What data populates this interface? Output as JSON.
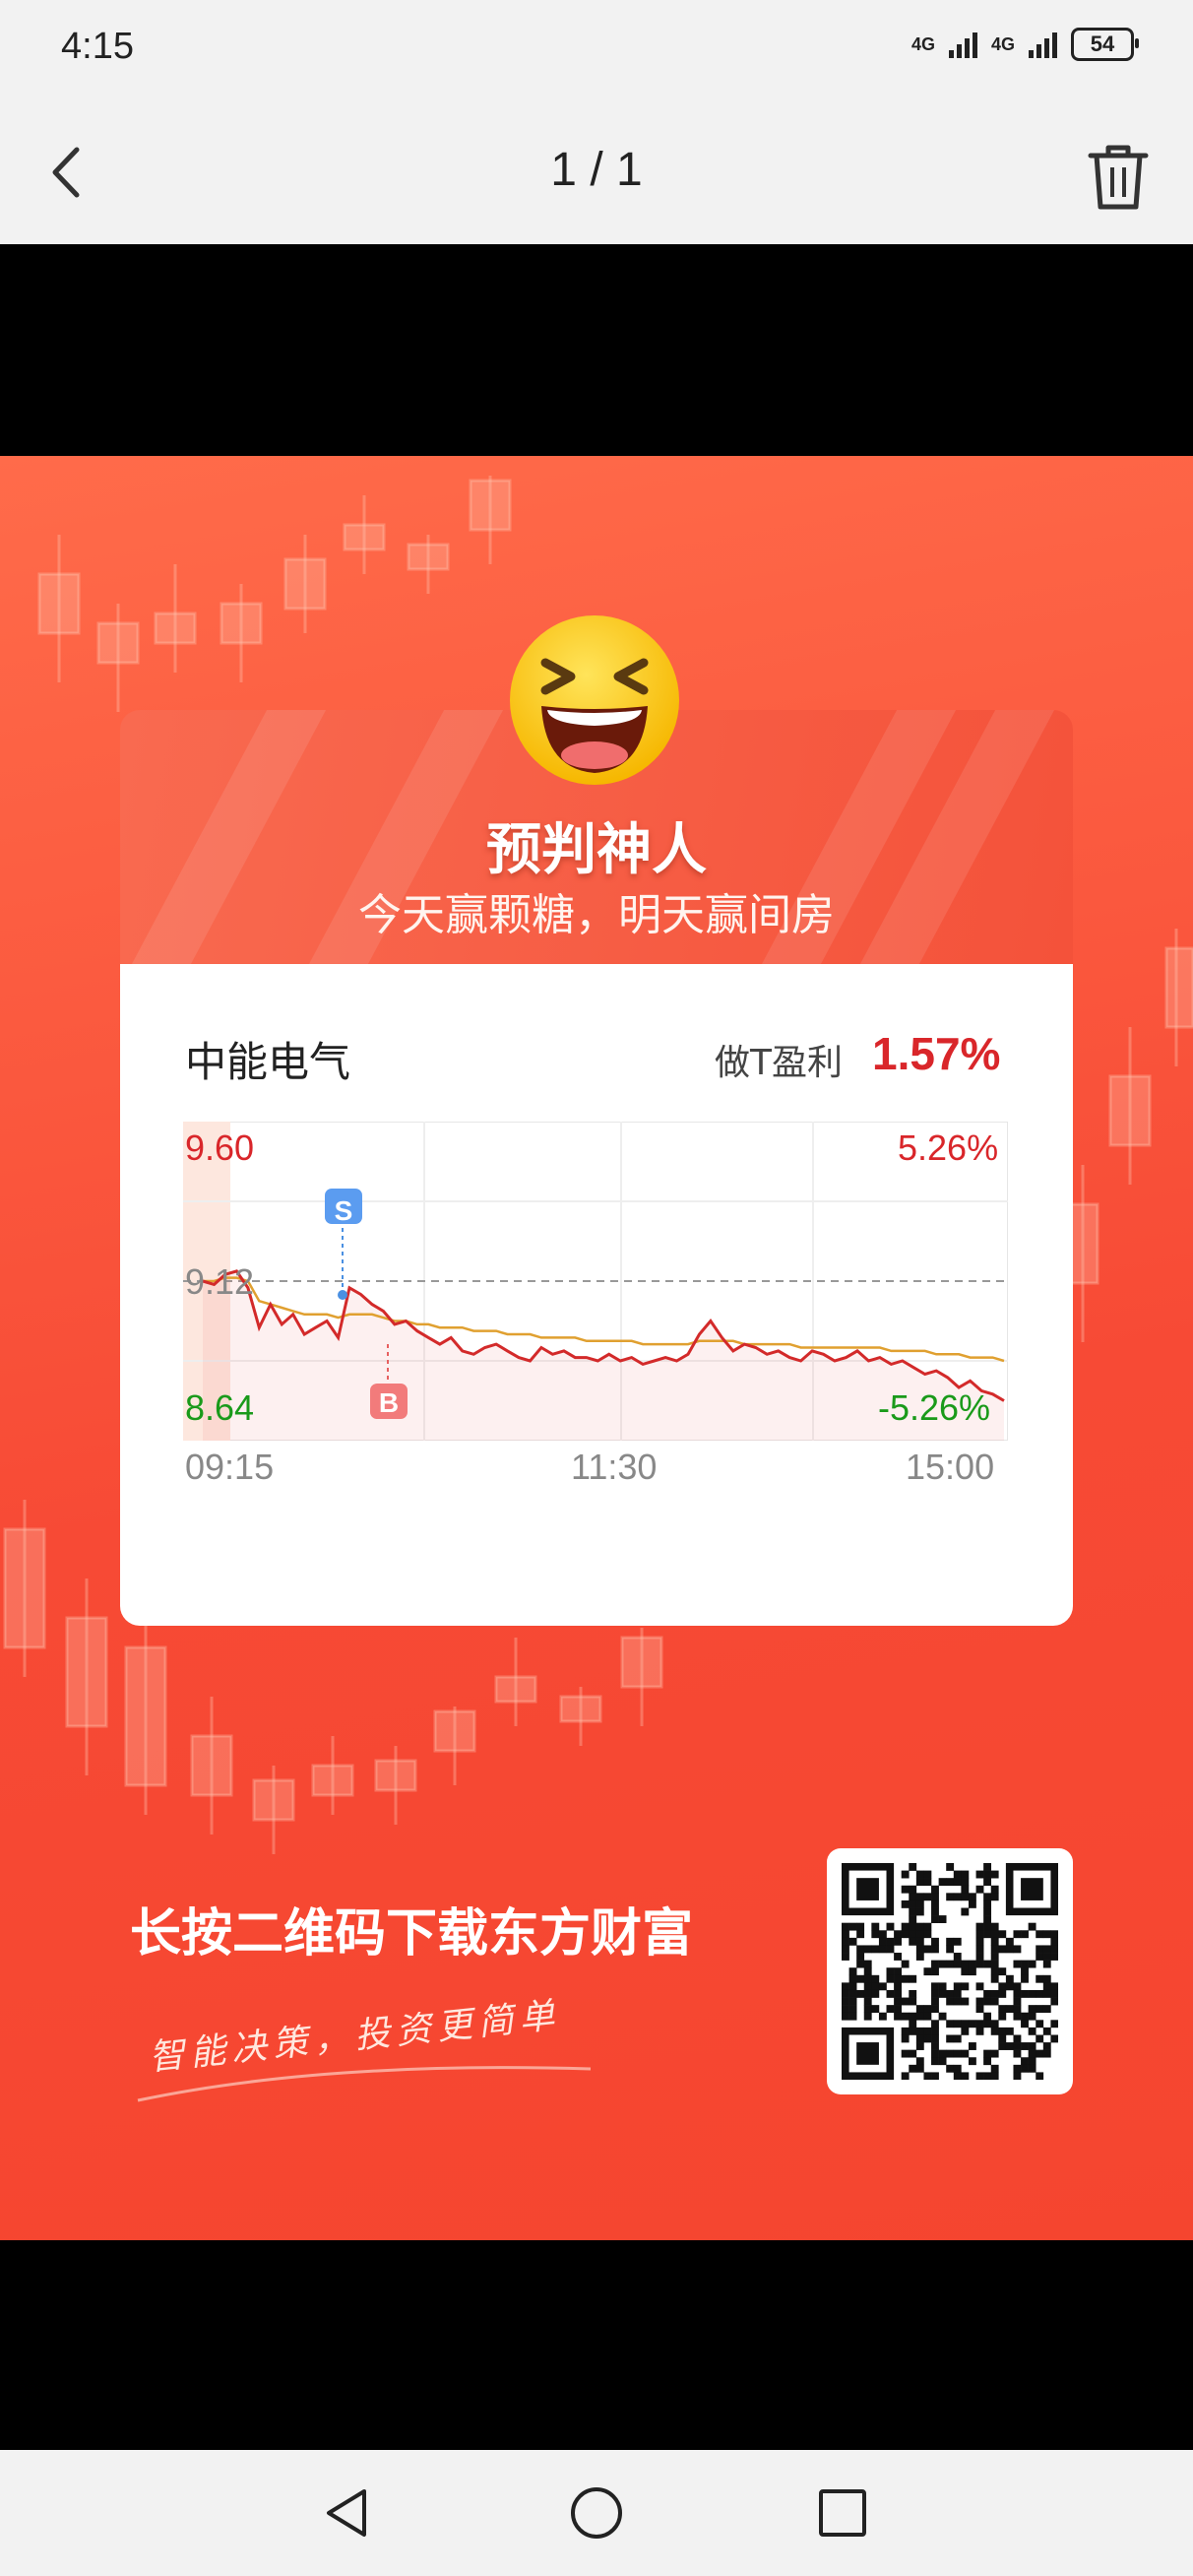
{
  "status_bar": {
    "time": "4:15",
    "net1": "4G",
    "net2": "4G",
    "battery": "54"
  },
  "viewer": {
    "counter": "1 / 1"
  },
  "poster": {
    "headline": "预判神人",
    "subtitle": "今天赢颗糖，明天赢间房",
    "stock_name": "中能电气",
    "profit_label": "做T盈利",
    "profit_value": "1.57%",
    "cta": "长按二维码下载东方财富",
    "slogan": "智能决策，投资更简单"
  },
  "chart_data": {
    "type": "line",
    "y_ticks_left": [
      "9.60",
      "9.12",
      "8.64"
    ],
    "y_ticks_right": [
      "5.26%",
      "-5.26%"
    ],
    "x_ticks": [
      "09:15",
      "11:30",
      "15:00"
    ],
    "markers": [
      "S",
      "B"
    ],
    "ylim": [
      8.64,
      9.6
    ],
    "series": [
      {
        "color": "#d32a2a",
        "y": [
          9.12,
          9.11,
          9.14,
          9.15,
          9.1,
          8.98,
          9.05,
          8.99,
          9.02,
          8.96,
          8.98,
          9.0,
          8.95,
          9.1,
          9.08,
          9.05,
          9.03,
          8.99,
          9.0,
          8.97,
          8.95,
          8.93,
          8.95,
          8.91,
          8.9,
          8.92,
          8.93,
          8.91,
          8.89,
          8.88,
          8.92,
          8.9,
          8.91,
          8.89,
          8.89,
          8.88,
          8.9,
          8.88,
          8.89,
          8.87,
          8.88,
          8.89,
          8.88,
          8.9,
          8.96,
          9.0,
          8.95,
          8.91,
          8.93,
          8.92,
          8.9,
          8.91,
          8.89,
          8.88,
          8.91,
          8.9,
          8.88,
          8.89,
          8.91,
          8.88,
          8.89,
          8.87,
          8.88,
          8.86,
          8.84,
          8.85,
          8.83,
          8.8,
          8.82,
          8.79,
          8.78,
          8.76
        ]
      },
      {
        "color": "#e0a030",
        "y": [
          9.12,
          9.12,
          9.13,
          9.13,
          9.12,
          9.06,
          9.05,
          9.04,
          9.03,
          9.02,
          9.02,
          9.02,
          9.01,
          9.02,
          9.02,
          9.02,
          9.01,
          9.0,
          9.0,
          8.99,
          8.99,
          8.98,
          8.98,
          8.98,
          8.97,
          8.97,
          8.97,
          8.96,
          8.96,
          8.96,
          8.95,
          8.95,
          8.95,
          8.95,
          8.94,
          8.94,
          8.94,
          8.94,
          8.94,
          8.93,
          8.93,
          8.93,
          8.93,
          8.93,
          8.94,
          8.94,
          8.94,
          8.94,
          8.93,
          8.93,
          8.93,
          8.93,
          8.93,
          8.92,
          8.92,
          8.92,
          8.92,
          8.92,
          8.92,
          8.92,
          8.92,
          8.91,
          8.91,
          8.91,
          8.91,
          8.9,
          8.9,
          8.9,
          8.89,
          8.89,
          8.89,
          8.88
        ]
      }
    ]
  }
}
